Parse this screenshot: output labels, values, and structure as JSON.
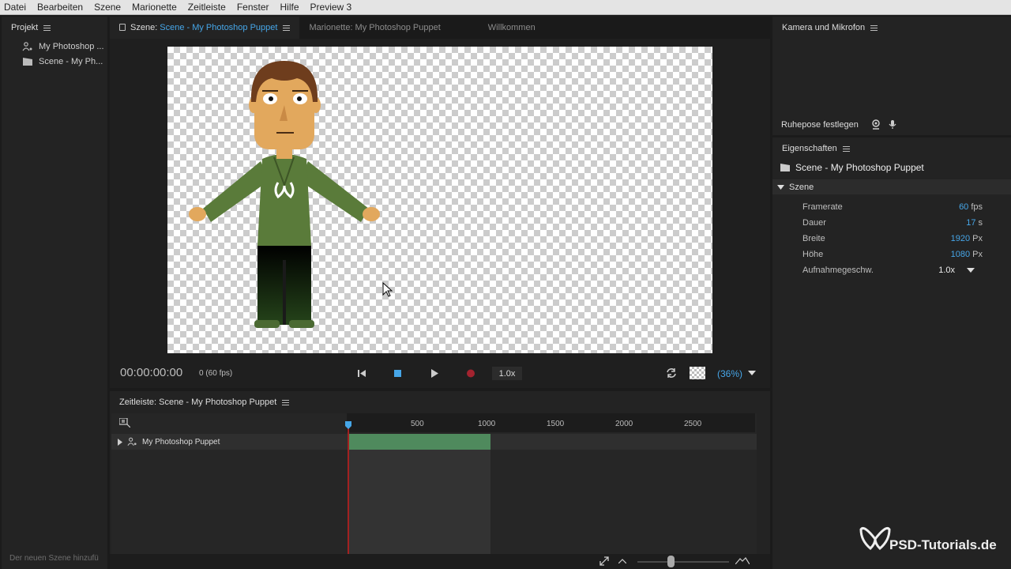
{
  "menu": [
    "Datei",
    "Bearbeiten",
    "Szene",
    "Marionette",
    "Zeitleiste",
    "Fenster",
    "Hilfe",
    "Preview 3"
  ],
  "project": {
    "title": "Projekt",
    "items": [
      {
        "label": "My Photoshop ...",
        "icon": "puppet-icon"
      },
      {
        "label": "Scene - My Ph...",
        "icon": "scene-icon"
      }
    ],
    "footer": "Der neuen Szene hinzufü"
  },
  "scene_panel": {
    "tab_prefix": "Szene:",
    "tab_active": "Scene - My Photoshop Puppet",
    "tab_marionette": "Marionette: My Photoshop Puppet",
    "tab_welcome": "Willkommen",
    "timecode": "00:00:00:00",
    "frame_info": "0 (60 fps)",
    "speed": "1.0x",
    "zoom": "(36%)"
  },
  "camera": {
    "title": "Kamera und Mikrofon",
    "rest_pose": "Ruhepose festlegen"
  },
  "properties": {
    "title": "Eigenschaften",
    "scene_name": "Scene - My Photoshop Puppet",
    "section": "Szene",
    "rows": [
      {
        "label": "Framerate",
        "value": "60",
        "unit": "fps"
      },
      {
        "label": "Dauer",
        "value": "17",
        "unit": "s"
      },
      {
        "label": "Breite",
        "value": "1920",
        "unit": "Px"
      },
      {
        "label": "Höhe",
        "value": "1080",
        "unit": "Px"
      }
    ],
    "rec_label": "Aufnahmegeschw.",
    "rec_value": "1.0x"
  },
  "timeline": {
    "title": "Zeitleiste: Scene - My Photoshop Puppet",
    "ticks": [
      "500",
      "1000",
      "1500",
      "2000",
      "2500"
    ],
    "track": "My Photoshop Puppet"
  },
  "watermark": "PSD-Tutorials.de",
  "colors": {
    "accent": "#46a6e8",
    "clip": "#4f8a5d",
    "playhead": "#a22121"
  }
}
